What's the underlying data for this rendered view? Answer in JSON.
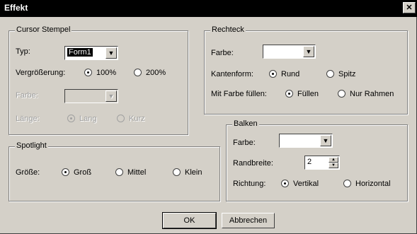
{
  "window": {
    "title": "Effekt",
    "close_glyph": "✕"
  },
  "cursor_stempel": {
    "legend": "Cursor Stempel",
    "typ_label": "Typ:",
    "typ_value": "Form1",
    "vergroesserung_label": "Vergrößerung:",
    "zoom_100": "100%",
    "zoom_200": "200%",
    "farbe_label": "Farbe:",
    "farbe_value": "",
    "laenge_label": "Länge:",
    "lang": "Lang",
    "kurz": "Kurz"
  },
  "rechteck": {
    "legend": "Rechteck",
    "farbe_label": "Farbe:",
    "farbe_value": "",
    "kantenform_label": "Kantenform:",
    "rund": "Rund",
    "spitz": "Spitz",
    "fuellen_label": "Mit Farbe füllen:",
    "fuellen": "Füllen",
    "nur_rahmen": "Nur Rahmen"
  },
  "spotlight": {
    "legend": "Spotlight",
    "groesse_label": "Größe:",
    "gross": "Groß",
    "mittel": "Mittel",
    "klein": "Klein"
  },
  "balken": {
    "legend": "Balken",
    "farbe_label": "Farbe:",
    "farbe_value": "",
    "randbreite_label": "Randbreite:",
    "randbreite_value": "2",
    "richtung_label": "Richtung:",
    "vertikal": "Vertikal",
    "horizontal": "Horizontal"
  },
  "buttons": {
    "ok": "OK",
    "cancel": "Abbrechen"
  },
  "icons": {
    "combo_arrow": "chevron-down-icon",
    "spin_up": "spin-up-icon",
    "spin_down": "spin-down-icon"
  }
}
